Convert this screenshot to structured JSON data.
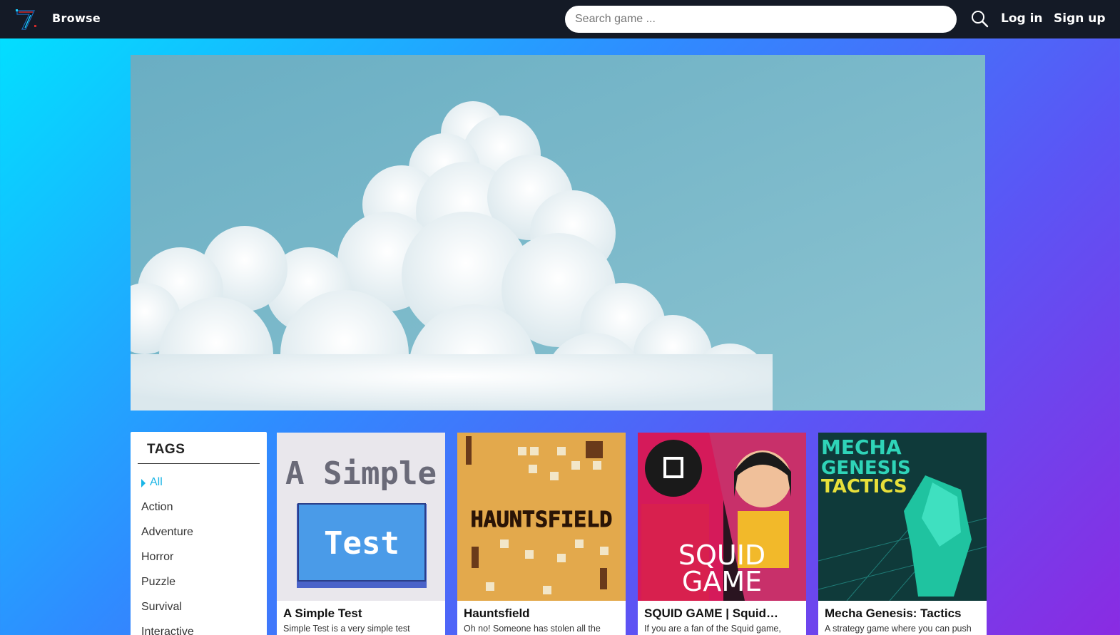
{
  "header": {
    "browse_label": "Browse",
    "search_placeholder": "Search game ...",
    "search_value": "",
    "login_label": "Log in",
    "signup_label": "Sign up",
    "logo_icon": "seven-logo-icon",
    "search_icon": "search-icon"
  },
  "colors": {
    "topbar": "#141a26",
    "tag_active": "#1ab5e6",
    "background_gradient": [
      "#00e3ff",
      "#2f8cff",
      "#5b55f5",
      "#8a2be2"
    ]
  },
  "tags": {
    "title": "TAGS",
    "items": [
      "All",
      "Action",
      "Adventure",
      "Horror",
      "Puzzle",
      "Survival",
      "Interactive"
    ],
    "active": "All"
  },
  "games": [
    {
      "title": "A Simple Test",
      "description": "Simple Test is a very simple test",
      "thumb_text": [
        "A Simple",
        "Test"
      ]
    },
    {
      "title": "Hauntsfield",
      "description": "Oh no! Someone has stolen all the",
      "thumb_text": [
        "HAUNTSFIELD"
      ]
    },
    {
      "title": "SQUID GAME | Squid…",
      "description": "If you are a fan of the Squid game,",
      "thumb_text": [
        "SQUID",
        "GAME"
      ]
    },
    {
      "title": "Mecha Genesis: Tactics",
      "description": "A strategy game where you can push",
      "thumb_text": [
        "MECHA",
        "GENESIS",
        "TACTICS"
      ]
    }
  ]
}
